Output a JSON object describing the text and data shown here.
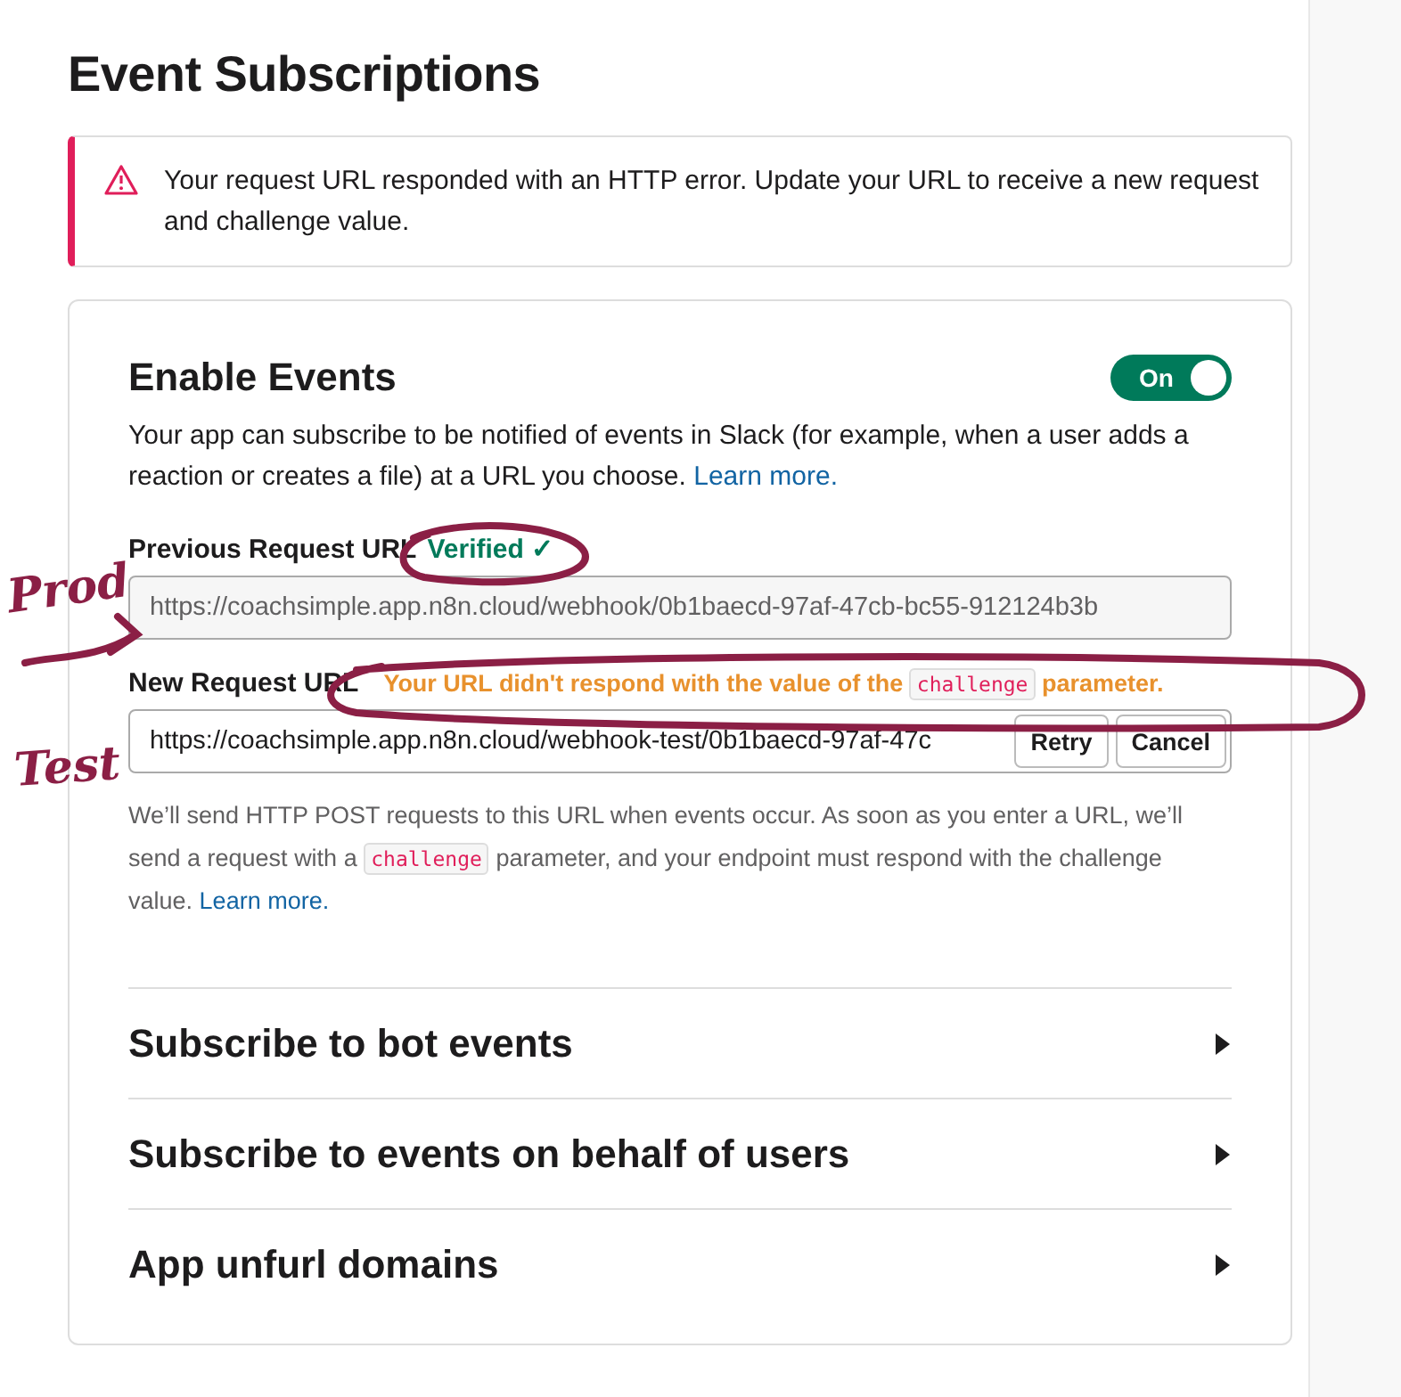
{
  "page": {
    "title": "Event Subscriptions"
  },
  "alert": {
    "kind": "error",
    "text": "Your request URL responded with an HTTP error. Update your URL to receive a new request and challenge value."
  },
  "enable_events": {
    "title": "Enable Events",
    "toggle": {
      "label": "On",
      "on": true
    },
    "description": "Your app can subscribe to be notified of events in Slack (for example, when a user adds a reaction or creates a file) at a URL you choose.",
    "link": "Learn more."
  },
  "previous_url": {
    "label": "Previous Request URL",
    "status": "Verified",
    "status_icon": "✓",
    "value": "https://coachsimple.app.n8n.cloud/webhook/0b1baecd-97af-47cb-bc55-912124b3b"
  },
  "new_url": {
    "label": "New Request URL",
    "error": {
      "before": "Your URL didn't respond with the value of the",
      "code": "challenge",
      "after": "parameter."
    },
    "value": "https://coachsimple.app.n8n.cloud/webhook-test/0b1baecd-97af-47c",
    "buttons": [
      "Retry",
      "Cancel"
    ]
  },
  "help": {
    "before": "We’ll send HTTP POST requests to this URL when events occur. As soon as you enter a URL, we’ll send a request with a",
    "code": "challenge",
    "after": "parameter, and your endpoint must respond with the challenge value.",
    "link": "Learn more."
  },
  "sections": [
    {
      "title": "Subscribe to bot events",
      "expanded": false
    },
    {
      "title": "Subscribe to events on behalf of users",
      "expanded": false
    },
    {
      "title": "App unfurl domains",
      "expanded": false
    }
  ],
  "annotations": [
    {
      "kind": "label",
      "text": "Prod"
    },
    {
      "kind": "arrow"
    },
    {
      "kind": "label",
      "text": "Test"
    },
    {
      "kind": "circle"
    },
    {
      "kind": "circle"
    }
  ]
}
